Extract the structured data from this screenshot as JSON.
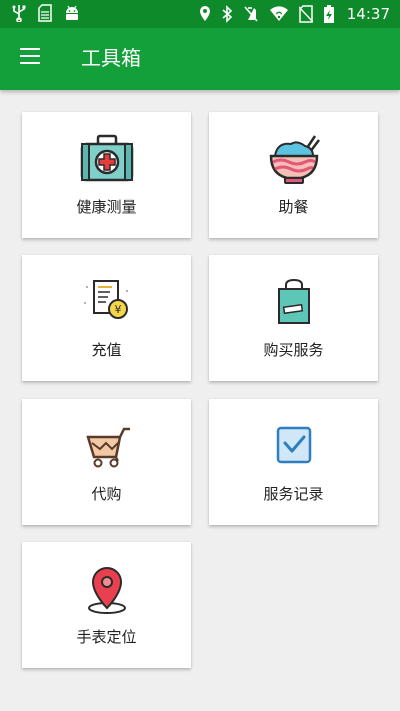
{
  "status_bar": {
    "time": "14:37",
    "left_icons": [
      "usb-icon",
      "sim-card-icon",
      "android-icon"
    ],
    "right_icons": [
      "location-icon",
      "bluetooth-icon",
      "vibrate-off-icon",
      "wifi-icon",
      "no-sim-icon",
      "battery-charging-icon"
    ]
  },
  "app_bar": {
    "title": "工具箱",
    "menu_icon": "hamburger-menu-icon",
    "background": "#13a03a",
    "status_background": "#0f8a2b"
  },
  "tools": [
    {
      "label": "健康测量",
      "icon": "medical-kit-icon"
    },
    {
      "label": "助餐",
      "icon": "food-bowl-icon"
    },
    {
      "label": "充值",
      "icon": "recharge-receipt-icon"
    },
    {
      "label": "购买服务",
      "icon": "shopping-bag-icon"
    },
    {
      "label": "代购",
      "icon": "shopping-cart-icon"
    },
    {
      "label": "服务记录",
      "icon": "checkbox-record-icon"
    },
    {
      "label": "手表定位",
      "icon": "location-pin-icon"
    }
  ]
}
